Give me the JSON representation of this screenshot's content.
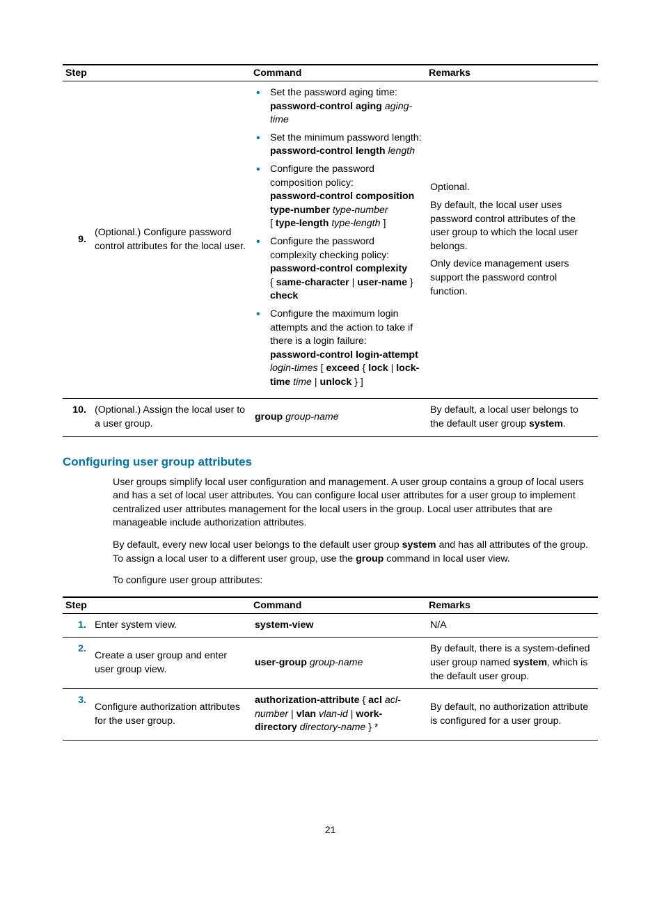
{
  "page_number": "21",
  "table1": {
    "headers": {
      "step": "Step",
      "command": "Command",
      "remarks": "Remarks"
    },
    "rows": [
      {
        "num": "9.",
        "step": "(Optional.) Configure password control attributes for the local user.",
        "command_items": [
          {
            "lead": "Set the password aging time:",
            "cmd_bold1": "password-control aging",
            "cmd_ital1": "aging-time"
          },
          {
            "lead": "Set the minimum password length:",
            "cmd_bold1": "password-control length",
            "cmd_ital1": "length"
          },
          {
            "lead": "Configure the password composition policy:",
            "cmd_bold1": "password-control composition type-number",
            "cmd_ital1": "type-number",
            "bracket_open": "[",
            "cmd_bold2": "type-length",
            "cmd_ital2": "type-length",
            "bracket_close": "]"
          },
          {
            "lead": "Configure the password complexity checking policy:",
            "cmd_bold1": "password-control complexity",
            "brace_open": "{",
            "cmd_bold2": "same-character",
            "pipe": "|",
            "cmd_bold3": "user-name",
            "brace_close": "}",
            "cmd_bold4": "check"
          },
          {
            "lead": "Configure the maximum login attempts and the action to take if there is a login failure:",
            "cmd_bold1": "password-control login-attempt",
            "cmd_ital1": "login-times",
            "bracket_open": "[",
            "cmd_bold2": "exceed",
            "brace_open": "{",
            "cmd_bold3": "lock",
            "pipe": "|",
            "cmd_bold4": "lock-time",
            "cmd_ital2": "time",
            "pipe2": "|",
            "cmd_bold5": "unlock",
            "brace_close": "}",
            "bracket_close": "]"
          }
        ],
        "remarks": {
          "p1": "Optional.",
          "p2": "By default, the local user uses password control attributes of the user group to which the local user belongs.",
          "p3": "Only device management users support the password control function."
        }
      },
      {
        "num": "10.",
        "step": "(Optional.) Assign the local user to a user group.",
        "command": {
          "bold": "group",
          "ital": "group-name"
        },
        "remarks": {
          "pre": "By default, a local user belongs to the default user group ",
          "bold": "system",
          "post": "."
        }
      }
    ]
  },
  "section_heading": "Configuring user group attributes",
  "para1": "User groups simplify local user configuration and management. A user group contains a group of local users and has a set of local user attributes. You can configure local user attributes for a user group to implement centralized user attributes management for the local users in the group. Local user attributes that are manageable include authorization attributes.",
  "para2_pre": "By default, every new local user belongs to the default user group ",
  "para2_b1": "system",
  "para2_mid": " and has all attributes of the group. To assign a local user to a different user group, use the ",
  "para2_b2": "group",
  "para2_post": " command in local user view.",
  "para3": "To configure user group attributes:",
  "table2": {
    "headers": {
      "step": "Step",
      "command": "Command",
      "remarks": "Remarks"
    },
    "rows": [
      {
        "num": "1.",
        "step": "Enter system view.",
        "command": {
          "bold": "system-view"
        },
        "remarks_text": "N/A"
      },
      {
        "num": "2.",
        "step": "Create a user group and enter user group view.",
        "command": {
          "bold": "user-group",
          "ital": "group-name"
        },
        "remarks": {
          "pre": "By default, there is a system-defined user group named ",
          "bold": "system",
          "post": ", which is the default user group."
        }
      },
      {
        "num": "3.",
        "step": "Configure authorization attributes for the user group.",
        "command_complex": {
          "b1": "authorization-attribute",
          "t1": " { ",
          "b2": "acl",
          "i1": "acl-number",
          "t2": " | ",
          "b3": "vlan",
          "i2": "vlan-id",
          "t3": " | ",
          "b4": "work-directory",
          "i3": "directory-name",
          "t4": " } *"
        },
        "remarks_text": "By default, no authorization attribute is configured for a user group."
      }
    ]
  }
}
